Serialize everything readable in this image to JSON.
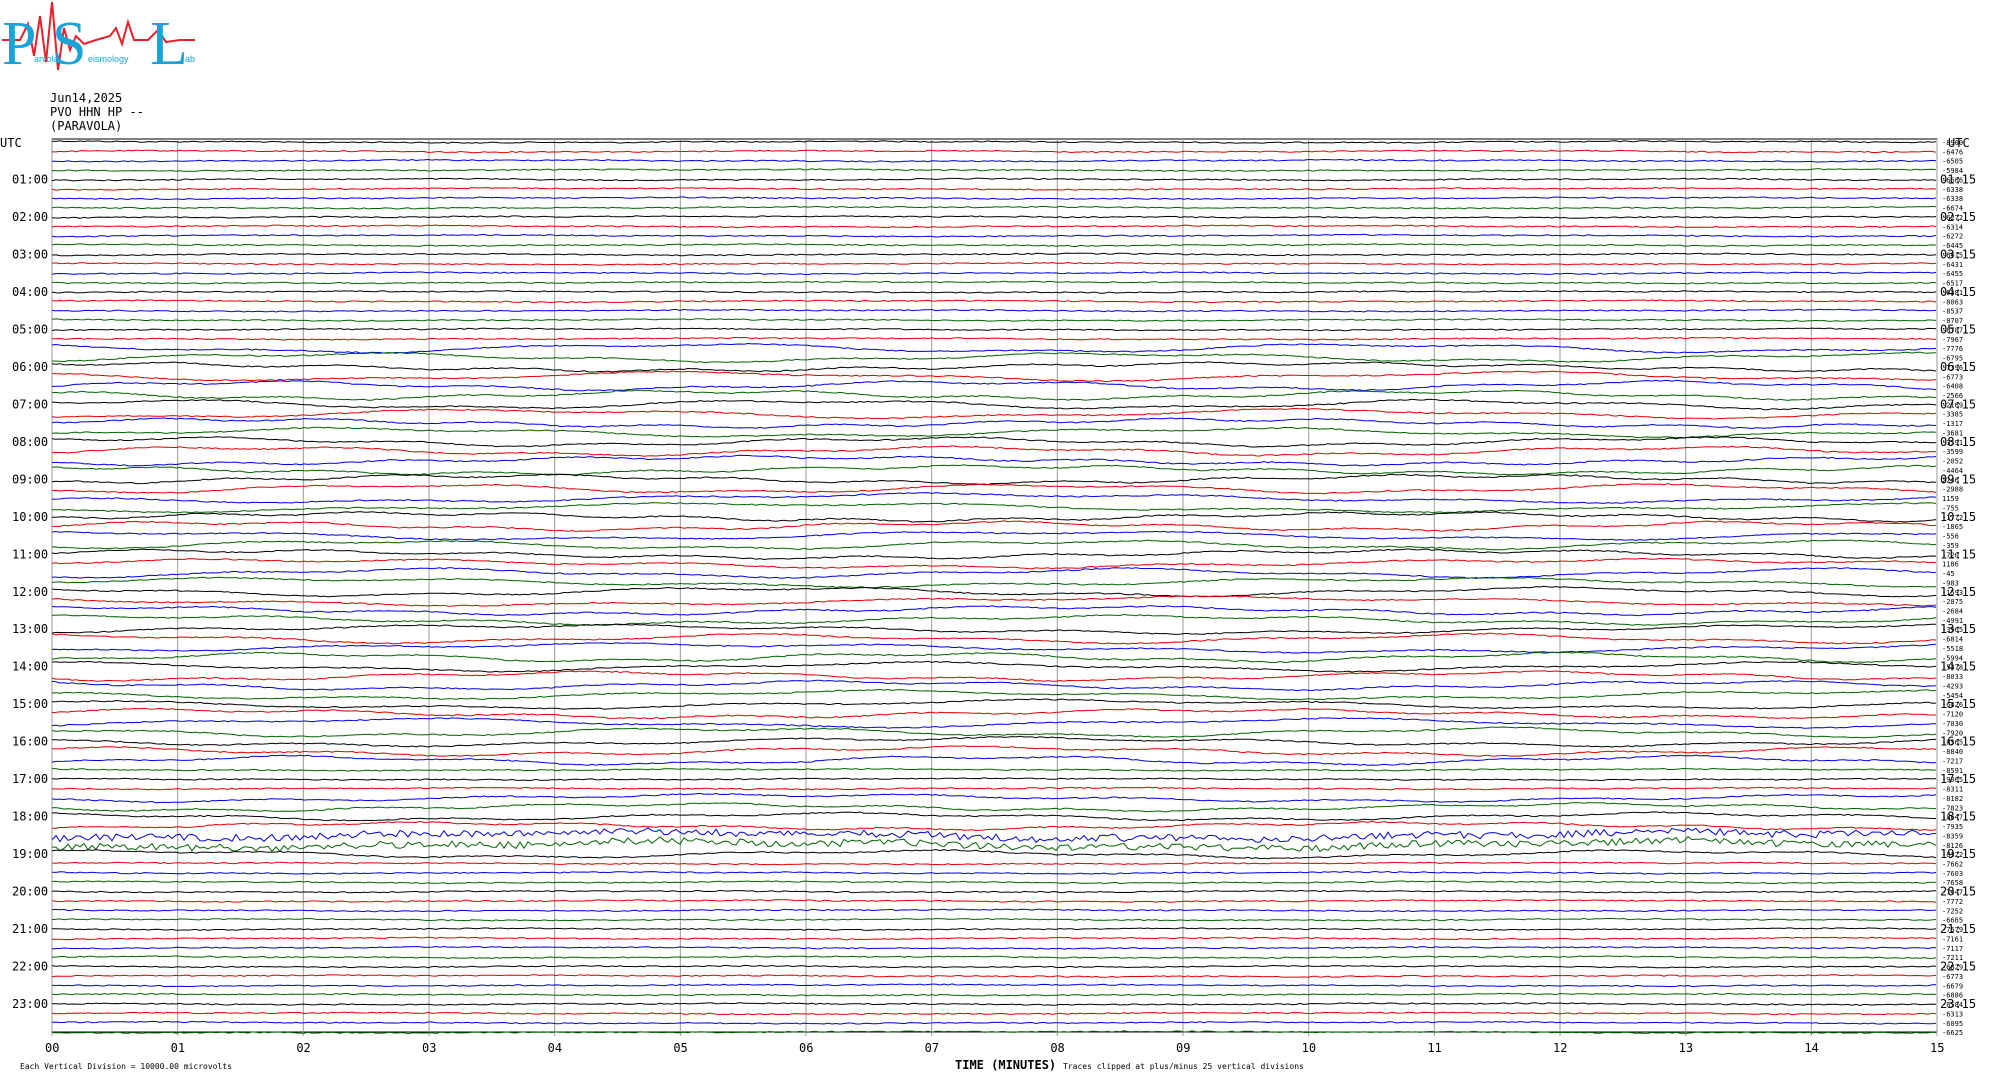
{
  "logo": {
    "big_letters": [
      "P",
      "S",
      "L"
    ],
    "small_text": [
      "arvola",
      "eismology",
      "ab"
    ],
    "colors": {
      "letters": "#1aa3d8",
      "wave": "#e8202a"
    }
  },
  "header": {
    "date": "Jun14,2025",
    "station": "PVO HHN HP --",
    "location": "(PARAVOLA)"
  },
  "left_axis": {
    "title": "UTC",
    "labels": [
      "01:00",
      "02:00",
      "03:00",
      "04:00",
      "05:00",
      "06:00",
      "07:00",
      "08:00",
      "09:00",
      "10:00",
      "11:00",
      "12:00",
      "13:00",
      "14:00",
      "15:00",
      "16:00",
      "17:00",
      "18:00",
      "19:00",
      "20:00",
      "21:00",
      "22:00",
      "23:00"
    ]
  },
  "right_axis": {
    "title": "UTC",
    "labels": [
      "01:15",
      "02:15",
      "03:15",
      "04:15",
      "05:15",
      "06:15",
      "07:15",
      "08:15",
      "09:15",
      "10:15",
      "11:15",
      "12:15",
      "13:15",
      "14:15",
      "15:15",
      "16:15",
      "17:15",
      "18:15",
      "19:15",
      "20:15",
      "21:15",
      "22:15",
      "23:15"
    ]
  },
  "trace_values": [
    "-8900",
    "-6476",
    "-6505",
    "-5984",
    "-6666",
    "-6338",
    "-6338",
    "-6674",
    "-6272",
    "-6314",
    "-6272",
    "-6445",
    "-6415",
    "-6431",
    "-6455",
    "-6517",
    "-6381",
    "-8063",
    "-8537",
    "-8707",
    "-8787",
    "-7967",
    "-7776",
    "-6795",
    "-7396",
    "-6773",
    "-6408",
    "-2566",
    "-2169",
    "-3385",
    "-1317",
    "-3681",
    "-3591",
    "-3599",
    "-2052",
    "-4464",
    "2246",
    "-2988",
    "1159",
    "-755",
    "-1772",
    "-1865",
    "-556",
    "-359",
    "-720",
    "1186",
    "-45",
    "-983",
    "-1593",
    "-2875",
    "-2684",
    "-4991",
    "-3965",
    "-6814",
    "-5518",
    "-5994",
    "-5378",
    "-8033",
    "-4293",
    "-5454",
    "-6426",
    "-7120",
    "-7030",
    "-7920",
    "-8565",
    "-8840",
    "-7217",
    "-8591",
    "-9065",
    "-8311",
    "-8182",
    "-7823",
    "-8647",
    "-7935",
    "-8359",
    "-8126",
    "-8322",
    "-7662",
    "-7603",
    "-7658",
    "-7447",
    "-7772",
    "-7252",
    "-6665",
    "-7579",
    "-7161",
    "-7117",
    "-7211",
    "-6829",
    "-6773",
    "-6679",
    "-6886",
    "-6584",
    "-6313",
    "-6095",
    "-6625"
  ],
  "x_axis": {
    "ticks": [
      "00",
      "01",
      "02",
      "03",
      "04",
      "05",
      "06",
      "07",
      "08",
      "09",
      "10",
      "11",
      "12",
      "13",
      "14",
      "15"
    ],
    "title": "TIME (MINUTES)"
  },
  "footer": {
    "left": "Each Vertical Division = 10000.00 microvolts",
    "right": "Traces clipped at plus/minus 25 vertical divisions"
  },
  "trace_colors": [
    "#000000",
    "#e00000",
    "#0000e0",
    "#006400"
  ]
}
